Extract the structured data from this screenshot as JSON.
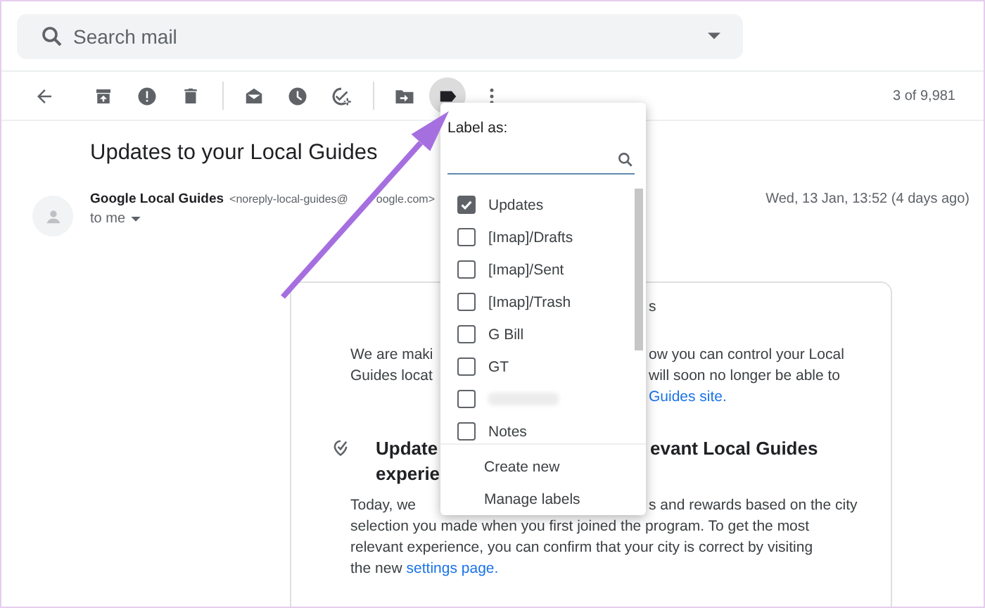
{
  "search": {
    "placeholder": "Search mail"
  },
  "toolbar": {
    "items": [
      {
        "kind": "back",
        "selected": false
      },
      {
        "kind": "archive",
        "selected": false
      },
      {
        "kind": "spam",
        "selected": false
      },
      {
        "kind": "delete",
        "selected": false
      },
      {
        "kind": "separator"
      },
      {
        "kind": "mark-unread",
        "selected": false
      },
      {
        "kind": "snooze",
        "selected": false
      },
      {
        "kind": "add-task",
        "selected": false
      },
      {
        "kind": "separator"
      },
      {
        "kind": "move",
        "selected": false
      },
      {
        "kind": "label",
        "selected": true
      },
      {
        "kind": "more",
        "selected": false
      }
    ],
    "pager": "3 of 9,981"
  },
  "email": {
    "subject": "Updates to your Local Guides",
    "sender": {
      "name": "Google Local Guides",
      "address": [
        "<noreply-local-guides@",
        "oogle.com>"
      ],
      "recipient": "to me"
    },
    "date": "Wed, 13 Jan, 13:52 (4 days ago)",
    "body": [
      {
        "kind": "text",
        "right": "s"
      },
      {
        "kind": "text",
        "left": "We are maki",
        "right": "ow you can control your Local"
      },
      {
        "kind": "text",
        "left": "Guides locat",
        "right": "will soon no longer be able to"
      },
      {
        "kind": "text",
        "link": "Guides site."
      },
      {
        "kind": "heading",
        "icon": true,
        "left": "Update",
        "right": "evant Local Guides"
      },
      {
        "kind": "heading",
        "left": "experie"
      },
      {
        "kind": "text",
        "left": "Today, we",
        "right": "s and rewards based on the city"
      },
      {
        "kind": "full",
        "text": "selection you made when you first joined the program. To get the most"
      },
      {
        "kind": "full",
        "text": "relevant experience, you can confirm that your city is correct by visiting"
      },
      {
        "kind": "full",
        "text": "the new",
        "link": "settings page."
      }
    ]
  },
  "label_menu": {
    "title": "Label as:",
    "labels": [
      {
        "name": "Updates",
        "checked": true
      },
      {
        "name": "[Imap]/Drafts",
        "checked": false
      },
      {
        "name": "[Imap]/Sent",
        "checked": false
      },
      {
        "name": "[Imap]/Trash",
        "checked": false
      },
      {
        "name": "G Bill",
        "checked": false
      },
      {
        "name": "GT",
        "checked": false
      },
      {
        "redacted": true,
        "checked": false
      },
      {
        "name": "Notes",
        "checked": false
      }
    ],
    "actions": [
      "Create new",
      "Manage labels"
    ]
  }
}
